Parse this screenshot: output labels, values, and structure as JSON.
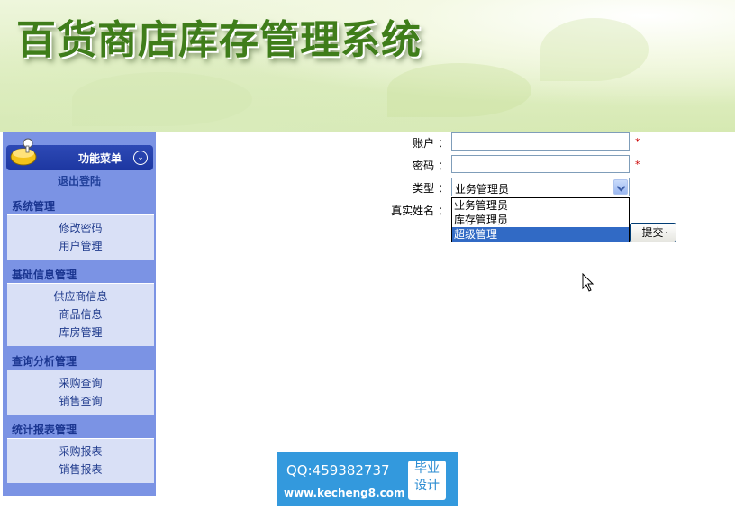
{
  "header": {
    "title": "百货商店库存管理系统"
  },
  "sidebar": {
    "menu_title": "功能菜单",
    "logout": "退出登陆",
    "groups": [
      {
        "title": "系统管理",
        "items": [
          "修改密码",
          "用户管理"
        ]
      },
      {
        "title": "基础信息管理",
        "items": [
          "供应商信息",
          "商品信息",
          "库房管理"
        ]
      },
      {
        "title": "查询分析管理",
        "items": [
          "采购查询",
          "销售查询"
        ]
      },
      {
        "title": "统计报表管理",
        "items": [
          "采购报表",
          "销售报表"
        ]
      }
    ]
  },
  "form": {
    "account_label": "账户 ：",
    "password_label": "密码 ：",
    "type_label": "类型 ：",
    "realname_label": "真实姓名 ：",
    "required_mark": "*",
    "account_value": "",
    "password_value": "",
    "type_selected": "业务管理员",
    "type_options": [
      "业务管理员",
      "库存管理员",
      "超级管理"
    ],
    "highlighted_option": "超级管理",
    "submit_label": "提交"
  },
  "watermark": {
    "qq": "QQ:459382737",
    "url": "www.kecheng8.com",
    "badge_line1": "毕业",
    "badge_line2": "设计"
  },
  "colors": {
    "sidebar_bg": "#7b93e4",
    "menu_header": "#1d37a1",
    "group_box": "#d9e0f6",
    "title_green": "#3f7d1a",
    "selection": "#316ac5",
    "watermark_bg": "#3399dd"
  }
}
